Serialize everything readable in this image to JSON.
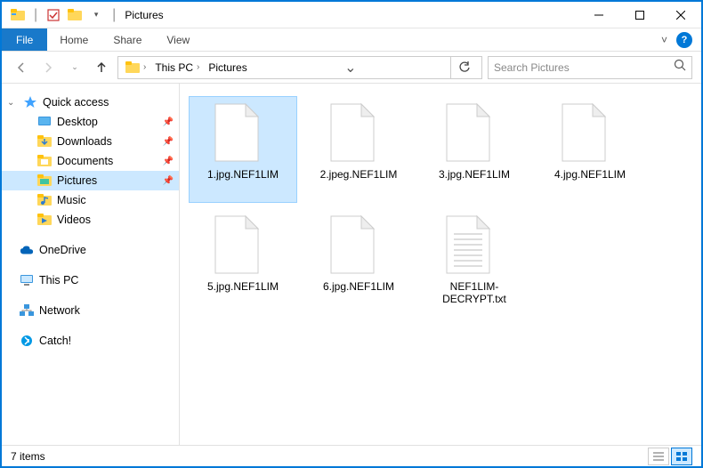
{
  "window": {
    "title": "Pictures"
  },
  "ribbon": {
    "file": "File",
    "tabs": [
      "Home",
      "Share",
      "View"
    ]
  },
  "address": {
    "breadcrumb": [
      "This PC",
      "Pictures"
    ],
    "search_placeholder": "Search Pictures"
  },
  "sidebar": {
    "quick_access": "Quick access",
    "quick_items": [
      {
        "label": "Desktop",
        "icon": "desktop",
        "pinned": true
      },
      {
        "label": "Downloads",
        "icon": "downloads",
        "pinned": true
      },
      {
        "label": "Documents",
        "icon": "documents",
        "pinned": true
      },
      {
        "label": "Pictures",
        "icon": "pictures",
        "pinned": true,
        "selected": true
      },
      {
        "label": "Music",
        "icon": "music",
        "pinned": false
      },
      {
        "label": "Videos",
        "icon": "videos",
        "pinned": false
      }
    ],
    "roots": [
      {
        "label": "OneDrive",
        "icon": "onedrive"
      },
      {
        "label": "This PC",
        "icon": "thispc"
      },
      {
        "label": "Network",
        "icon": "network"
      },
      {
        "label": "Catch!",
        "icon": "catch"
      }
    ]
  },
  "files": [
    {
      "name": "1.jpg.NEF1LIM",
      "type": "blank",
      "selected": true
    },
    {
      "name": "2.jpeg.NEF1LIM",
      "type": "blank"
    },
    {
      "name": "3.jpg.NEF1LIM",
      "type": "blank"
    },
    {
      "name": "4.jpg.NEF1LIM",
      "type": "blank"
    },
    {
      "name": "5.jpg.NEF1LIM",
      "type": "blank"
    },
    {
      "name": "6.jpg.NEF1LIM",
      "type": "blank"
    },
    {
      "name": "NEF1LIM-DECRYPT.txt",
      "type": "text"
    }
  ],
  "status": {
    "count": "7 items"
  }
}
